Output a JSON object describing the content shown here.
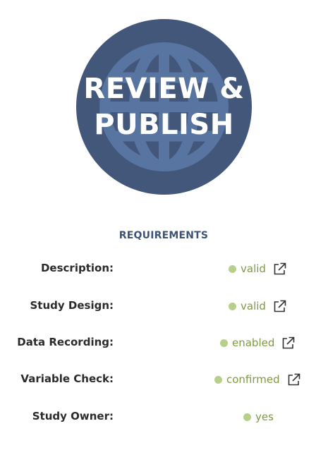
{
  "hero": {
    "title_line1": "REVIEW &",
    "title_line2": "PUBLISH",
    "icon": "globe-icon",
    "colors": {
      "circle": "#42577a",
      "globe": "#5874a0",
      "title": "#ffffff"
    }
  },
  "requirements": {
    "heading": "REQUIREMENTS",
    "items": [
      {
        "label": "Description:",
        "status": "valid",
        "has_link": true
      },
      {
        "label": "Study Design:",
        "status": "valid",
        "has_link": true
      },
      {
        "label": "Data Recording:",
        "status": "enabled",
        "has_link": true
      },
      {
        "label": "Variable Check:",
        "status": "confirmed",
        "has_link": true
      },
      {
        "label": "Study Owner:",
        "status": "yes",
        "has_link": false
      }
    ],
    "status_colors": {
      "dot": "#b7cf8a",
      "text": "#7e9a44"
    },
    "link_icon": "external-link-icon"
  }
}
